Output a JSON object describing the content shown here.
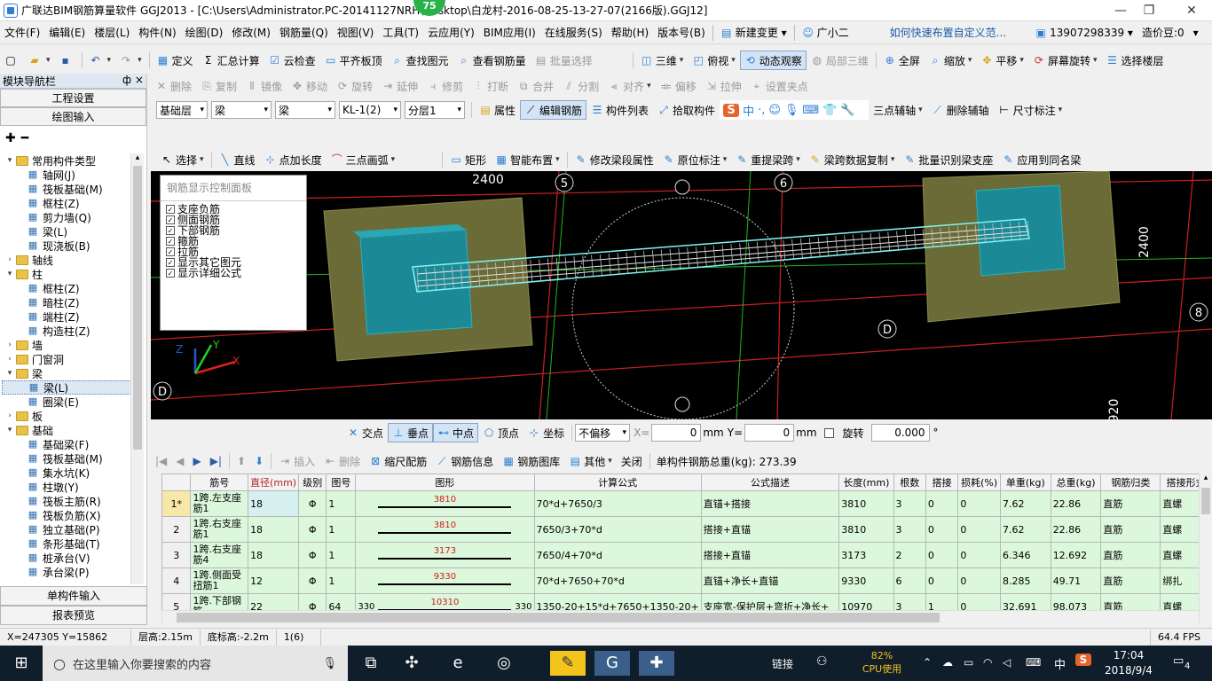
{
  "window": {
    "title": "广联达BIM钢筋算量软件 GGJ2013 - [C:\\Users\\Administrator.PC-20141127NRH\\Desktop\\白龙村-2016-08-25-13-27-07(2166版).GGJ12]",
    "badge": "75"
  },
  "menu": {
    "items": [
      "文件(F)",
      "编辑(E)",
      "楼层(L)",
      "构件(N)",
      "绘图(D)",
      "修改(M)",
      "钢筋量(Q)",
      "视图(V)",
      "工具(T)",
      "云应用(Y)",
      "BIM应用(I)",
      "在线服务(S)",
      "帮助(H)",
      "版本号(B)"
    ],
    "new_change": "新建变更",
    "guangxiaoer": "广小二",
    "tip": "如何快速布置自定义范...",
    "phone": "13907298339",
    "zaojia": "造价豆:0"
  },
  "toolbar1": {
    "define": "定义",
    "sum": "汇总计算",
    "cloud_check": "云检查",
    "align_top": "平齐板顶",
    "find": "查找图元",
    "view_rebar": "查看钢筋量",
    "batch_select": "批量选择",
    "view3d": "三维",
    "plan": "俯视",
    "dynamic": "动态观察",
    "local3d": "局部三维",
    "fullscreen": "全屏",
    "zoom": "缩放",
    "pan": "平移",
    "rotate_screen": "屏幕旋转",
    "select_floor": "选择楼层"
  },
  "toolbar2": {
    "items": [
      "删除",
      "复制",
      "镜像",
      "移动",
      "旋转",
      "延伸",
      "修剪",
      "打断",
      "合并",
      "分割",
      "对齐",
      "偏移",
      "拉伸",
      "设置夹点"
    ]
  },
  "toolbar3": {
    "floor": "基础层",
    "type1": "梁",
    "type2": "梁",
    "element": "KL-1(2)",
    "layer": "分层1",
    "props": "属性",
    "edit_rebar": "编辑钢筋",
    "list": "构件列表",
    "pick": "拾取构件",
    "three_point_axis": "三点辅轴",
    "del_axis": "删除辅轴",
    "dim": "尺寸标注"
  },
  "toolbar4": {
    "select": "选择",
    "line": "直线",
    "add_len": "点加长度",
    "arc": "三点画弧",
    "rect": "矩形",
    "smart": "智能布置",
    "modify_seg": "修改梁段属性",
    "orig_label": "原位标注",
    "re_span": "重提梁跨",
    "span_copy": "梁跨数据复制",
    "batch_support": "批量识别梁支座",
    "apply_same": "应用到同名梁"
  },
  "nav": {
    "title": "模块导航栏",
    "pin": "ф ×",
    "tab_eng": "工程设置",
    "tab_draw": "绘图输入",
    "tab_single": "单构件输入",
    "tab_report": "报表预览",
    "tree": [
      {
        "level": 0,
        "exp": "▾",
        "kind": "folder",
        "label": "常用构件类型"
      },
      {
        "level": 1,
        "kind": "item",
        "label": "轴网(J)"
      },
      {
        "level": 1,
        "kind": "item",
        "label": "筏板基础(M)"
      },
      {
        "level": 1,
        "kind": "item",
        "label": "框柱(Z)"
      },
      {
        "level": 1,
        "kind": "item",
        "label": "剪力墙(Q)"
      },
      {
        "level": 1,
        "kind": "item",
        "label": "梁(L)"
      },
      {
        "level": 1,
        "kind": "item",
        "label": "现浇板(B)"
      },
      {
        "level": 0,
        "exp": "›",
        "kind": "folder",
        "label": "轴线"
      },
      {
        "level": 0,
        "exp": "▾",
        "kind": "folder",
        "label": "柱"
      },
      {
        "level": 1,
        "kind": "item",
        "label": "框柱(Z)"
      },
      {
        "level": 1,
        "kind": "item",
        "label": "暗柱(Z)"
      },
      {
        "level": 1,
        "kind": "item",
        "label": "端柱(Z)"
      },
      {
        "level": 1,
        "kind": "item",
        "label": "构造柱(Z)"
      },
      {
        "level": 0,
        "exp": "›",
        "kind": "folder",
        "label": "墙"
      },
      {
        "level": 0,
        "exp": "›",
        "kind": "folder",
        "label": "门窗洞"
      },
      {
        "level": 0,
        "exp": "▾",
        "kind": "folder",
        "label": "梁"
      },
      {
        "level": 1,
        "kind": "item",
        "label": "梁(L)",
        "selected": true
      },
      {
        "level": 1,
        "kind": "item",
        "label": "圈梁(E)"
      },
      {
        "level": 0,
        "exp": "›",
        "kind": "folder",
        "label": "板"
      },
      {
        "level": 0,
        "exp": "▾",
        "kind": "folder",
        "label": "基础"
      },
      {
        "level": 1,
        "kind": "item",
        "label": "基础梁(F)"
      },
      {
        "level": 1,
        "kind": "item",
        "label": "筏板基础(M)"
      },
      {
        "level": 1,
        "kind": "item",
        "label": "集水坑(K)"
      },
      {
        "level": 1,
        "kind": "item",
        "label": "柱墩(Y)"
      },
      {
        "level": 1,
        "kind": "item",
        "label": "筏板主筋(R)"
      },
      {
        "level": 1,
        "kind": "item",
        "label": "筏板负筋(X)"
      },
      {
        "level": 1,
        "kind": "item",
        "label": "独立基础(P)"
      },
      {
        "level": 1,
        "kind": "item",
        "label": "条形基础(T)"
      },
      {
        "level": 1,
        "kind": "item",
        "label": "桩承台(V)"
      },
      {
        "level": 1,
        "kind": "item",
        "label": "承台梁(P)"
      }
    ]
  },
  "control_panel": {
    "title": "钢筋显示控制面板",
    "options": [
      "支座负筋",
      "侧面钢筋",
      "下部钢筋",
      "箍筋",
      "拉筋",
      "显示其它图元",
      "显示详细公式"
    ]
  },
  "viewport": {
    "dim_top": "2400",
    "dim_right": "2400",
    "dim_br": "920",
    "axis_5": "5",
    "axis_6": "6",
    "axis_8": "8",
    "axis_d": "D",
    "ax_z": "Z",
    "ax_y": "Y",
    "ax_x": "X",
    "ime": [
      "中",
      "♪"
    ]
  },
  "snap": {
    "intersect": "交点",
    "perp": "垂点",
    "mid": "中点",
    "vertex": "顶点",
    "coord": "坐标",
    "offset_mode": "不偏移",
    "x_label": "X=",
    "x_val": "0",
    "mm1": "mm",
    "y_label": "Y=",
    "y_val": "0",
    "mm2": "mm",
    "rotate": "旋转",
    "rotate_val": "0.000",
    "deg": "°"
  },
  "bottom_toolbar": {
    "insert": "插入",
    "delete": "删除",
    "scale": "缩尺配筋",
    "info": "钢筋信息",
    "lib": "钢筋图库",
    "other": "其他",
    "close": "关闭",
    "total": "单构件钢筋总重(kg): 273.39"
  },
  "grid": {
    "columns": [
      "筋号",
      "直径(mm)",
      "级别",
      "图号",
      "图形",
      "计算公式",
      "公式描述",
      "长度(mm)",
      "根数",
      "搭接",
      "损耗(%)",
      "单重(kg)",
      "总重(kg)",
      "钢筋归类",
      "搭接形式"
    ],
    "rows": [
      {
        "no": "1*",
        "name": "1跨.左支座筋1",
        "dia": "18",
        "grade": "Φ",
        "fig": "1",
        "shape_left": "",
        "shape_val": "3810",
        "shape_right": "",
        "formula": "70*d+7650/3",
        "desc": "直锚+搭接",
        "len": "3810",
        "count": "3",
        "lap": "0",
        "loss": "0",
        "unit": "7.62",
        "total": "22.86",
        "cat": "直筋",
        "lap_type": "直螺"
      },
      {
        "no": "2",
        "name": "1跨.右支座筋1",
        "dia": "18",
        "grade": "Φ",
        "fig": "1",
        "shape_left": "",
        "shape_val": "3810",
        "shape_right": "",
        "formula": "7650/3+70*d",
        "desc": "搭接+直锚",
        "len": "3810",
        "count": "3",
        "lap": "0",
        "loss": "0",
        "unit": "7.62",
        "total": "22.86",
        "cat": "直筋",
        "lap_type": "直螺"
      },
      {
        "no": "3",
        "name": "1跨.右支座筋4",
        "dia": "18",
        "grade": "Φ",
        "fig": "1",
        "shape_left": "",
        "shape_val": "3173",
        "shape_right": "",
        "formula": "7650/4+70*d",
        "desc": "搭接+直锚",
        "len": "3173",
        "count": "2",
        "lap": "0",
        "loss": "0",
        "unit": "6.346",
        "total": "12.692",
        "cat": "直筋",
        "lap_type": "直螺"
      },
      {
        "no": "4",
        "name": "1跨.侧面受扭筋1",
        "dia": "12",
        "grade": "Φ",
        "fig": "1",
        "shape_left": "",
        "shape_val": "9330",
        "shape_right": "",
        "formula": "70*d+7650+70*d",
        "desc": "直锚+净长+直锚",
        "len": "9330",
        "count": "6",
        "lap": "0",
        "loss": "0",
        "unit": "8.285",
        "total": "49.71",
        "cat": "直筋",
        "lap_type": "绑扎"
      },
      {
        "no": "5",
        "name": "1跨.下部钢筋",
        "dia": "22",
        "grade": "Φ",
        "fig": "64",
        "shape_left": "330",
        "shape_val": "10310",
        "shape_right": "330",
        "formula": "1350-20+15*d+7650+1350-20+",
        "desc": "支座宽-保护层+弯折+净长+",
        "len": "10970",
        "count": "3",
        "lap": "1",
        "loss": "0",
        "unit": "32.691",
        "total": "98.073",
        "cat": "直筋",
        "lap_type": "直螺"
      }
    ]
  },
  "status": {
    "coords": "X=247305 Y=15862",
    "floor_h": "层高:2.15m",
    "bottom_h": "底标高:-2.2m",
    "count": "1(6)",
    "fps": "64.4 FPS"
  },
  "taskbar": {
    "search_placeholder": "在这里输入你要搜索的内容",
    "link": "链接",
    "cpu_pct": "82%",
    "cpu_label": "CPU使用",
    "ime": "中",
    "time": "17:04",
    "date": "2018/9/4",
    "notif": "4"
  },
  "colors": {
    "accent": "#2d7fd3",
    "grid_row": "#dcf8dc",
    "taskbar": "#101d2b",
    "canvas": "#000000"
  }
}
